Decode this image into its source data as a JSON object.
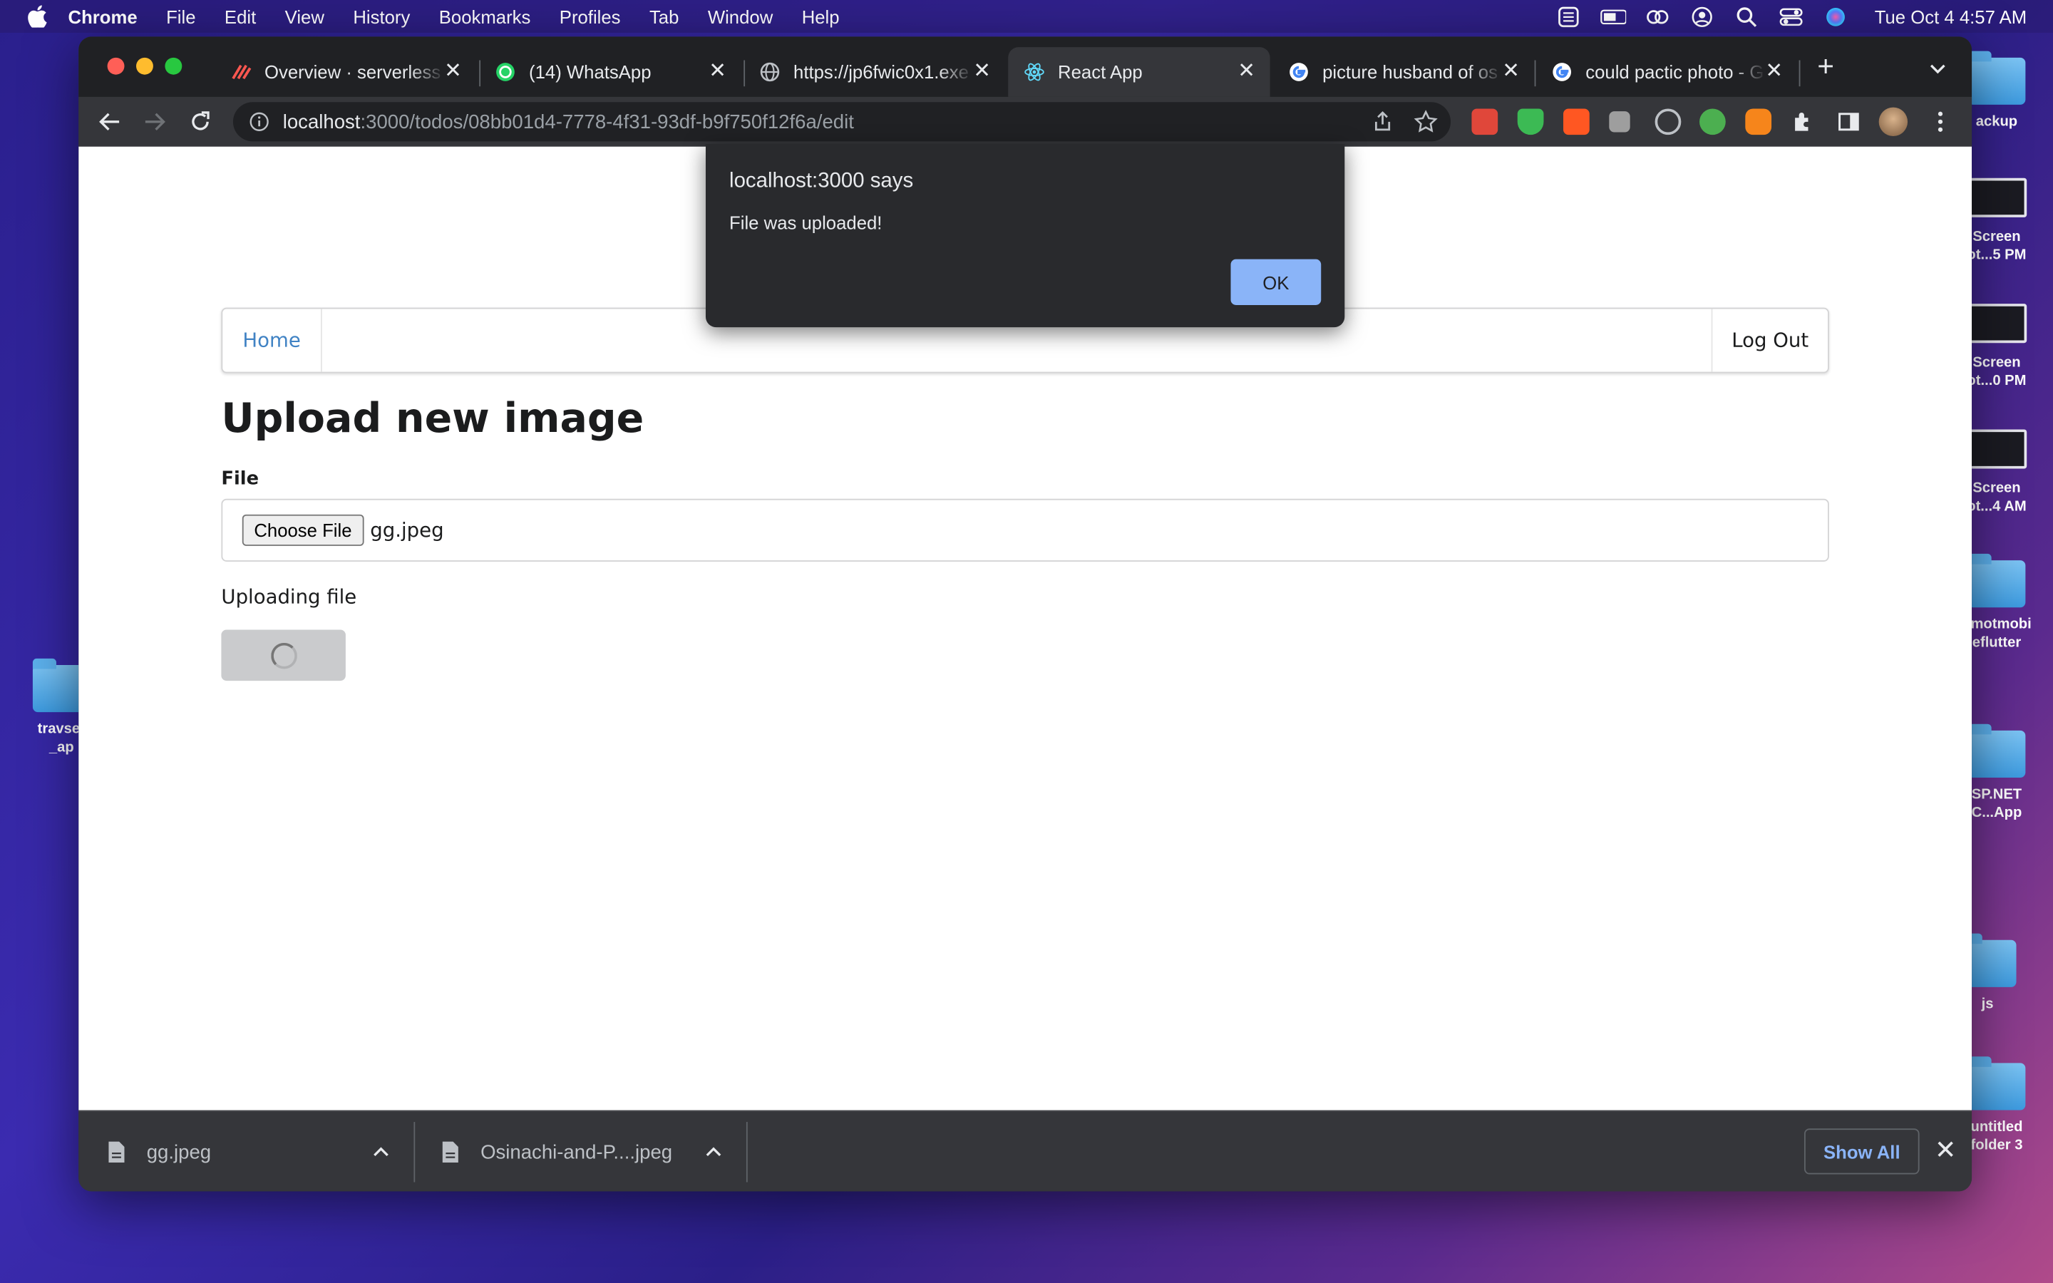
{
  "menubar": {
    "app_name": "Chrome",
    "items": [
      "File",
      "Edit",
      "View",
      "History",
      "Bookmarks",
      "Profiles",
      "Tab",
      "Window",
      "Help"
    ],
    "clock": "Tue Oct 4  4:57 AM"
  },
  "desktop": {
    "icons": [
      "ackup",
      "Screen\not...5 PM",
      "Screen\not...0 PM",
      "Screen\not...4 AM",
      "omotmobi\neflutter",
      "SP.NET\nC...App",
      "js",
      "untitled\nfolder 3",
      "travser\n_ap"
    ]
  },
  "browser": {
    "tabs": [
      {
        "title": "Overview · serverless",
        "icon": "serverless-icon"
      },
      {
        "title": "(14) WhatsApp",
        "icon": "whatsapp-icon"
      },
      {
        "title": "https://jp6fwic0x1.exe",
        "icon": "globe-icon"
      },
      {
        "title": "React App",
        "icon": "react-icon"
      },
      {
        "title": "picture husband of os",
        "icon": "google-icon"
      },
      {
        "title": "could pactic photo - G",
        "icon": "google-icon"
      }
    ],
    "active_tab": 3,
    "url_host": "localhost",
    "url_rest": ":3000/todos/08bb01d4-7778-4f31-93df-b9f750f12f6a/edit"
  },
  "page": {
    "nav": {
      "home": "Home",
      "logout": "Log Out"
    },
    "title": "Upload new image",
    "file_label": "File",
    "choose_file": "Choose File",
    "file_name": "gg.jpeg",
    "status": "Uploading file"
  },
  "dialog": {
    "title": "localhost:3000 says",
    "message": "File was uploaded!",
    "ok": "OK"
  },
  "downloads": {
    "items": [
      "gg.jpeg",
      "Osinachi-and-P....jpeg"
    ],
    "show_all": "Show All"
  }
}
